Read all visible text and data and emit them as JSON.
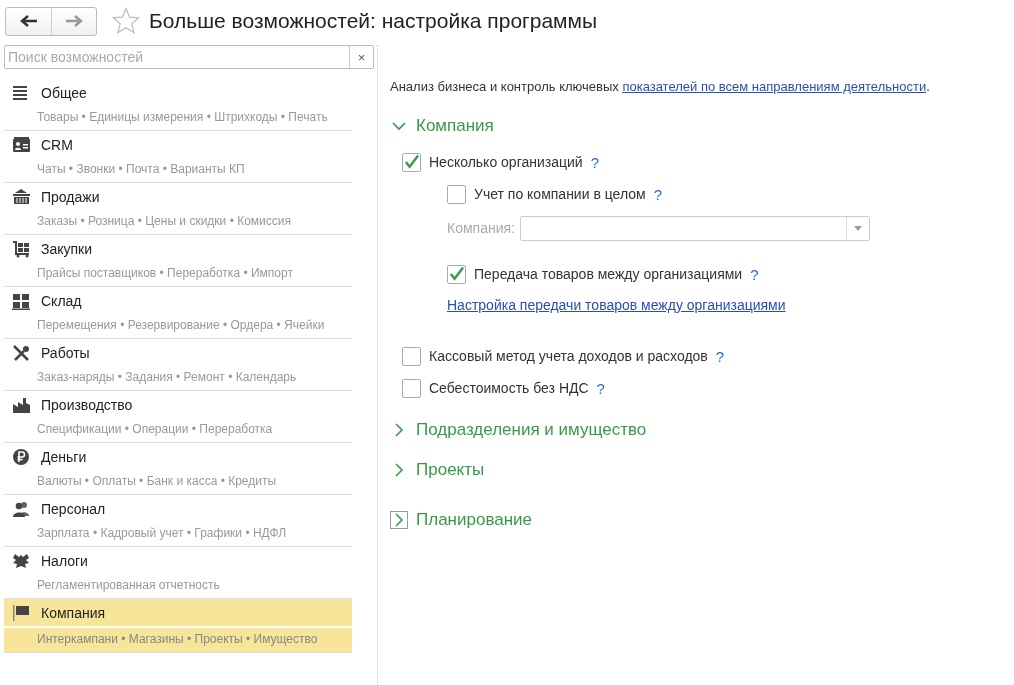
{
  "window": {
    "title": "Больше возможностей: настройка программы",
    "favorite": false
  },
  "search": {
    "placeholder": "Поиск возможностей",
    "clear": "×"
  },
  "sidebar": {
    "items": [
      {
        "title": "Общее",
        "subtitle": "Товары • Единицы измерения • Штрихкоды • Печать",
        "selected": false
      },
      {
        "title": "CRM",
        "subtitle": "Чаты • Звонки • Почта • Варианты КП",
        "selected": false
      },
      {
        "title": "Продажи",
        "subtitle": "Заказы • Розница • Цены и скидки • Комиссия",
        "selected": false
      },
      {
        "title": "Закупки",
        "subtitle": "Прайсы поставщиков • Переработка • Импорт",
        "selected": false
      },
      {
        "title": "Склад",
        "subtitle": "Перемещения • Резервирование • Ордера • Ячейки",
        "selected": false
      },
      {
        "title": "Работы",
        "subtitle": "Заказ-наряды • Задания • Ремонт • Календарь",
        "selected": false
      },
      {
        "title": "Производство",
        "subtitle": "Спецификации • Операции • Переработка",
        "selected": false
      },
      {
        "title": "Деньги",
        "subtitle": "Валюты • Оплаты • Банк и касса • Кредиты",
        "selected": false
      },
      {
        "title": "Персонал",
        "subtitle": "Зарплата • Кадровый учет • Графики • НДФЛ",
        "selected": false
      },
      {
        "title": "Налоги",
        "subtitle": "Регламентированная отчетность",
        "selected": false
      },
      {
        "title": "Компания",
        "subtitle": "Интеркампани • Магазины • Проекты • Имущество",
        "selected": true
      }
    ]
  },
  "content": {
    "intro": {
      "text": "Анализ бизнеса и контроль ключевых",
      "link": "показателей по всем направлениям деятельности",
      "end": "."
    },
    "sections": [
      {
        "title": "Компания",
        "expanded": true,
        "focused": false,
        "items": [
          {
            "kind": "checkbox",
            "label": "Несколько организаций",
            "checked": true,
            "help": "?",
            "children": [
              {
                "kind": "checkbox",
                "label": "Учет по компании в целом",
                "checked": false,
                "help": "?"
              },
              {
                "kind": "field",
                "label": "Компания:",
                "disabled": true
              },
              {
                "kind": "checkbox",
                "label": "Передача товаров между организациями",
                "checked": true,
                "help": "?"
              },
              {
                "kind": "link",
                "label": "Настройка передачи товаров между организациями"
              }
            ]
          },
          {
            "kind": "checkbox",
            "label": "Кассовый метод учета доходов и расходов",
            "checked": false,
            "help": "?"
          },
          {
            "kind": "checkbox",
            "label": "Себестоимость без НДС",
            "checked": false,
            "help": "?"
          }
        ]
      },
      {
        "title": "Подразделения и имущество",
        "expanded": false,
        "focused": false
      },
      {
        "title": "Проекты",
        "expanded": false,
        "focused": false
      },
      {
        "title": "Планирование",
        "expanded": false,
        "focused": true
      }
    ]
  }
}
